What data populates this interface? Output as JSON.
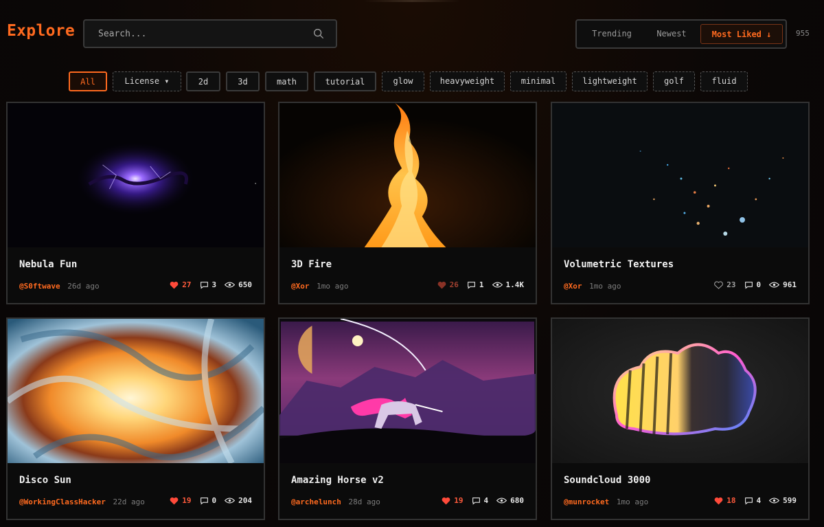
{
  "header": {
    "title": "Explore",
    "search_placeholder": "Search...",
    "sort": {
      "trending": "Trending",
      "newest": "Newest",
      "most_liked": "Most Liked ↓"
    },
    "count": "955"
  },
  "filters": [
    "All",
    "License ▾",
    "2d",
    "3d",
    "math",
    "tutorial",
    "glow",
    "heavyweight",
    "minimal",
    "lightweight",
    "golf",
    "fluid"
  ],
  "cards": [
    {
      "title": "Nebula Fun",
      "author": "@S0ftwave",
      "age": "26d ago",
      "likes": "27",
      "comments": "3",
      "views": "650"
    },
    {
      "title": "3D Fire",
      "author": "@Xor",
      "age": "1mo ago",
      "likes": "26",
      "comments": "1",
      "views": "1.4K"
    },
    {
      "title": "Volumetric Textures",
      "author": "@Xor",
      "age": "1mo ago",
      "likes": "23",
      "comments": "0",
      "views": "961"
    },
    {
      "title": "Disco Sun",
      "author": "@WorkingClassHacker",
      "age": "22d ago",
      "likes": "19",
      "comments": "0",
      "views": "204"
    },
    {
      "title": "Amazing Horse v2",
      "author": "@archelunch",
      "age": "28d ago",
      "likes": "19",
      "comments": "4",
      "views": "680"
    },
    {
      "title": "Soundcloud 3000",
      "author": "@munrocket",
      "age": "1mo ago",
      "likes": "18",
      "comments": "4",
      "views": "599"
    }
  ],
  "colors": {
    "accent": "#ff6a1f",
    "heart": "#ff5a3c",
    "background": "#0b0706"
  }
}
